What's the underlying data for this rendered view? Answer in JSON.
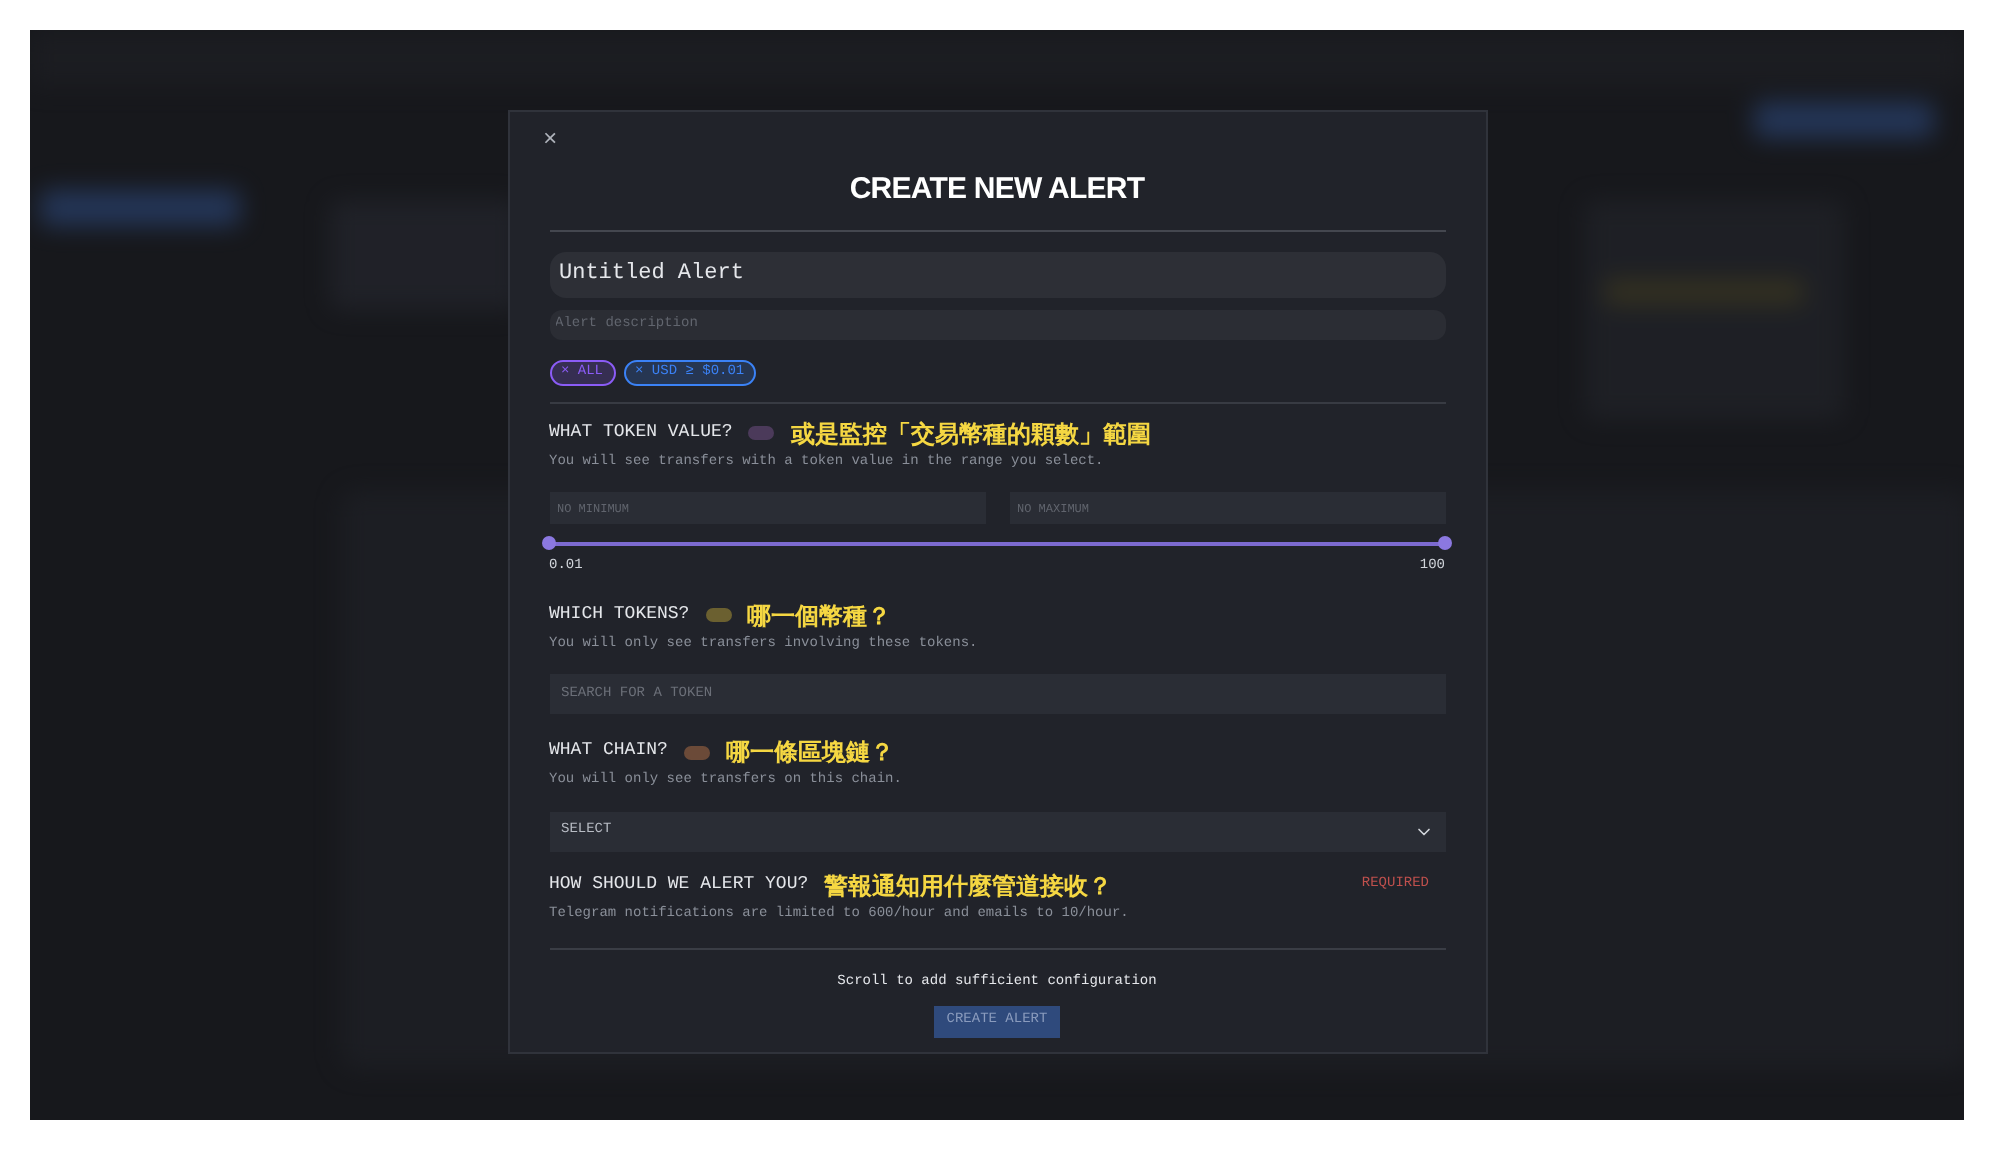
{
  "modal": {
    "close": "×",
    "title": "CREATE NEW ALERT",
    "name_field": {
      "value": "Untitled Alert"
    },
    "description_field": {
      "placeholder": "Alert description"
    },
    "filter_chips": [
      {
        "label": "× ALL",
        "color": "#8b5cf6"
      },
      {
        "label": "× USD ≥ $0.01",
        "color": "#3b82f6"
      }
    ],
    "sections": [
      {
        "kind": "range",
        "heading": "WHAT TOKEN VALUE?",
        "color": "#4b3a5a",
        "annotation": "或是監控「交易幣種的顆數」範圍",
        "hint": "You will see transfers with a token value in the range you select.",
        "min_field": {
          "placeholder": "NO MINIMUM"
        },
        "max_field": {
          "placeholder": "NO MAXIMUM"
        },
        "slider": {
          "thumbs": [
            {
              "level": 0
            },
            {
              "level": 1
            }
          ],
          "min_label": "0.01",
          "max_label": "100"
        }
      },
      {
        "kind": "search",
        "heading": "WHICH TOKENS?",
        "color": "#6b6030",
        "annotation": "哪一個幣種？",
        "hint": "You will only see transfers involving these tokens.",
        "field": {
          "placeholder": "SEARCH FOR A TOKEN"
        }
      },
      {
        "kind": "select",
        "heading": "WHAT CHAIN?",
        "color": "#6b4a38",
        "annotation": "哪一條區塊鏈？",
        "hint": "You will only see transfers on this chain.",
        "field": {
          "value": "SELECT"
        }
      },
      {
        "kind": "notify",
        "heading": "HOW SHOULD WE ALERT YOU?",
        "annotation": "警報通知用什麼管道接收？",
        "badge": "REQUIRED",
        "hint": "Telegram notifications are limited to 600/hour and emails to 10/hour."
      }
    ],
    "footer_note": "Scroll to add sufficient configuration",
    "submit": {
      "label": "CREATE ALERT",
      "disabled": true
    }
  }
}
